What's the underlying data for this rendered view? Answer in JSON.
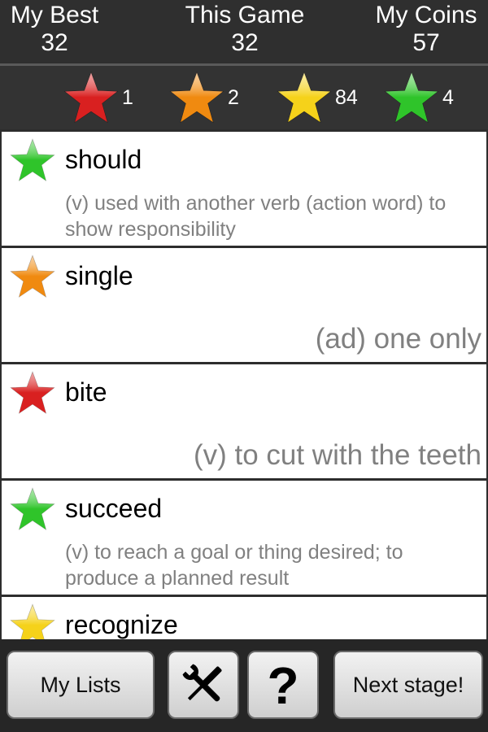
{
  "stats": {
    "best_label": "My Best",
    "best_value": "32",
    "game_label": "This Game",
    "game_value": "32",
    "coins_label": "My Coins",
    "coins_value": "57"
  },
  "star_counts": {
    "red": "1",
    "orange": "2",
    "yellow": "84",
    "green": "4"
  },
  "colors": {
    "red": "#d92020",
    "orange": "#f08a10",
    "yellow": "#f5d21a",
    "green": "#2fc42a"
  },
  "words": [
    {
      "word": "should",
      "star": "green",
      "definition": "(v) used with another verb (action word) to show responsibility"
    },
    {
      "word": "single",
      "star": "orange",
      "definition": "(ad) one only"
    },
    {
      "word": "bite",
      "star": "red",
      "definition": "(v) to cut with the teeth"
    },
    {
      "word": "succeed",
      "star": "green",
      "definition": "(v) to reach a goal or thing desired; to produce a planned result"
    },
    {
      "word": "recognize",
      "star": "yellow",
      "definition": ""
    }
  ],
  "toolbar": {
    "lists_label": "My Lists",
    "tools_icon": "tools-icon",
    "help_icon": "question-mark-icon",
    "next_label": "Next stage!"
  }
}
